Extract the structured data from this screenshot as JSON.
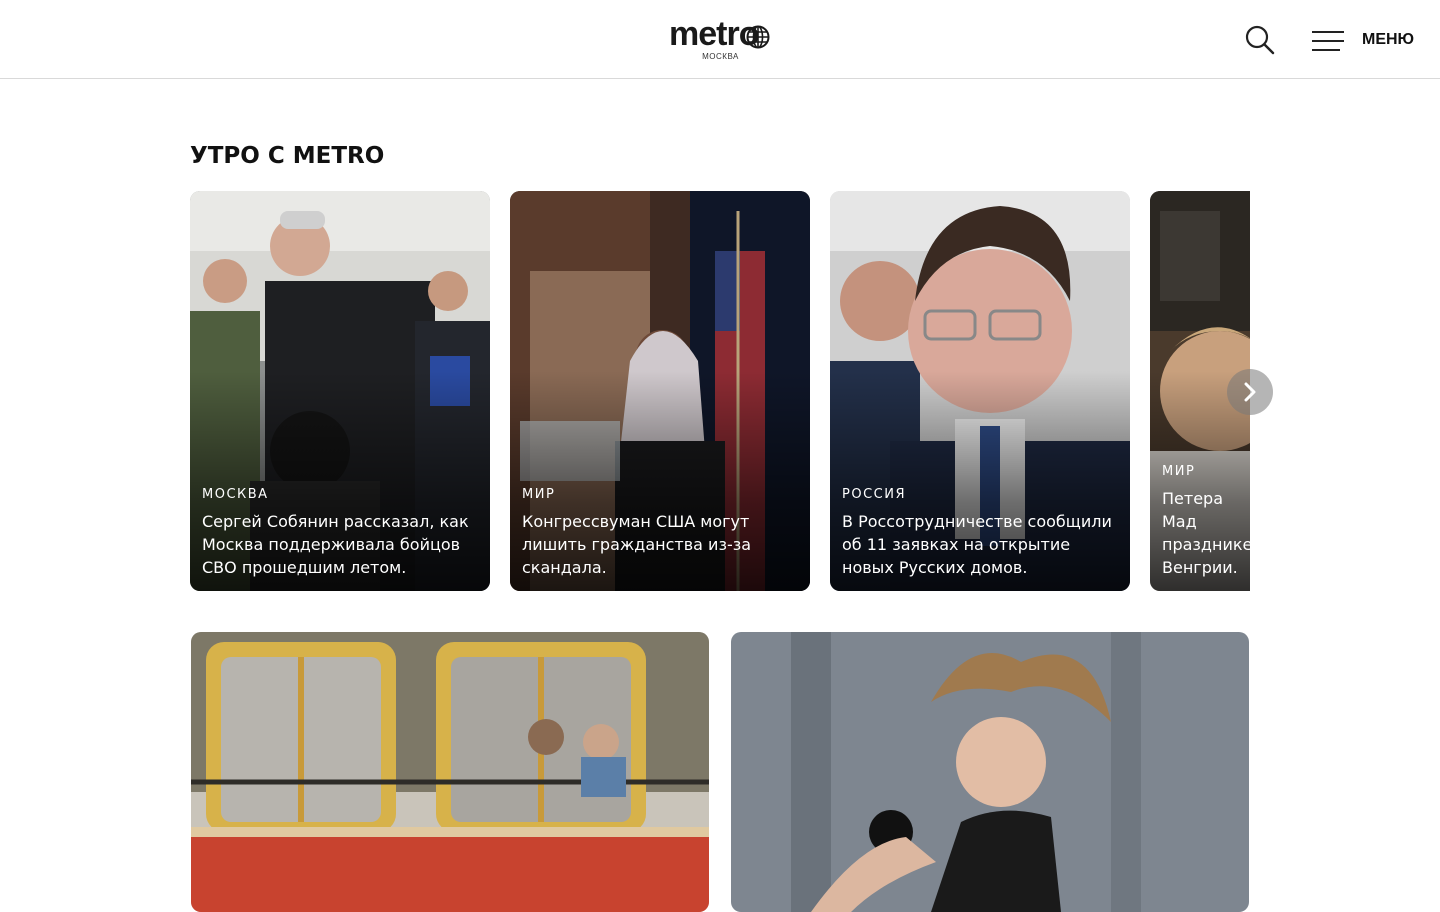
{
  "header": {
    "logo_text": "metro",
    "logo_city": "МОСКВА",
    "search_icon": "search-icon",
    "menu_icon": "hamburger-icon",
    "menu_label": "МЕНЮ"
  },
  "section": {
    "title": "УТРО С METRO",
    "cards": [
      {
        "category": "МОСКВА",
        "headline": "Сергей Собянин рассказал, как Москва поддерживала бойцов СВО прошедшим летом."
      },
      {
        "category": "МИР",
        "headline": "Конгрессвуман США могут лишить гражданства из-за скандала."
      },
      {
        "category": "РОССИЯ",
        "headline": "В Россотрудничестве сообщили об 11 заявках на открытие новых Русских домов."
      },
      {
        "category": "МИР",
        "headline": "Петера Мад празднике Венгрии."
      }
    ],
    "next_icon": "chevron-right-icon"
  },
  "colors": {
    "text": "#111111",
    "header_border": "#d9d9d9",
    "card_text": "#ffffff"
  }
}
